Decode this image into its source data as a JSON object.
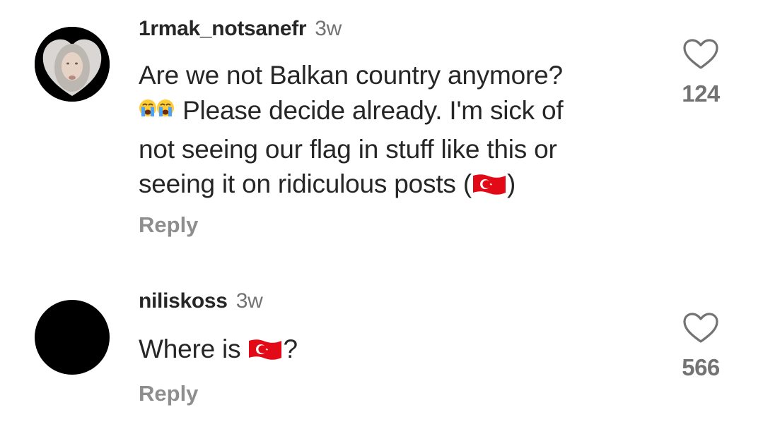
{
  "comments": [
    {
      "username": "1rmak_notsanefr",
      "time": "3w",
      "text_line1": "Are we not Balkan country anymore?",
      "text_line2": " Please decide already. I'm sick of",
      "text_line3": "not seeing our flag in stuff like this or",
      "text_line4_start": "seeing it on ridiculous posts (",
      "text_line4_end": ")",
      "reply_label": "Reply",
      "likes": "124"
    },
    {
      "username": "niliskoss",
      "time": "3w",
      "text_start": "Where is ",
      "text_end": "?",
      "reply_label": "Reply",
      "likes": "566"
    }
  ],
  "icons": {
    "heart": "heart-outline-icon",
    "crying_face": "loudly-crying-face-emoji",
    "flag": "turkey-flag-emoji"
  },
  "colors": {
    "text": "#262626",
    "secondary": "#737373",
    "reply": "#8e8e8e",
    "flag_red": "#e30a17"
  }
}
